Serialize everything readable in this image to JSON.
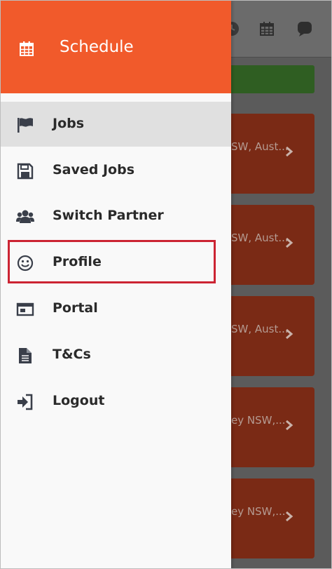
{
  "drawer": {
    "header": {
      "title": "Schedule",
      "icon": "calendar-icon",
      "color": "#f15a2b"
    },
    "items": [
      {
        "label": "Jobs",
        "icon": "flag-icon",
        "active": true
      },
      {
        "label": "Saved Jobs",
        "icon": "floppy-disk-icon",
        "active": false
      },
      {
        "label": "Switch Partner",
        "icon": "users-icon",
        "active": false
      },
      {
        "label": "Profile",
        "icon": "smiley-icon",
        "active": false,
        "highlighted": true
      },
      {
        "label": "Portal",
        "icon": "window-icon",
        "active": false
      },
      {
        "label": "T&Cs",
        "icon": "document-icon",
        "active": false
      },
      {
        "label": "Logout",
        "icon": "sign-in-icon",
        "active": false
      }
    ],
    "highlight_color": "#cc2433"
  },
  "background": {
    "top_icons": [
      "clock-icon",
      "calendar-icon",
      "chat-icon"
    ],
    "cards": [
      {
        "location": "SW, Aust..."
      },
      {
        "location": "SW, Aust..."
      },
      {
        "location": "SW, Aust..."
      },
      {
        "location": "ey NSW,..."
      },
      {
        "location": "ey NSW,..."
      }
    ]
  }
}
